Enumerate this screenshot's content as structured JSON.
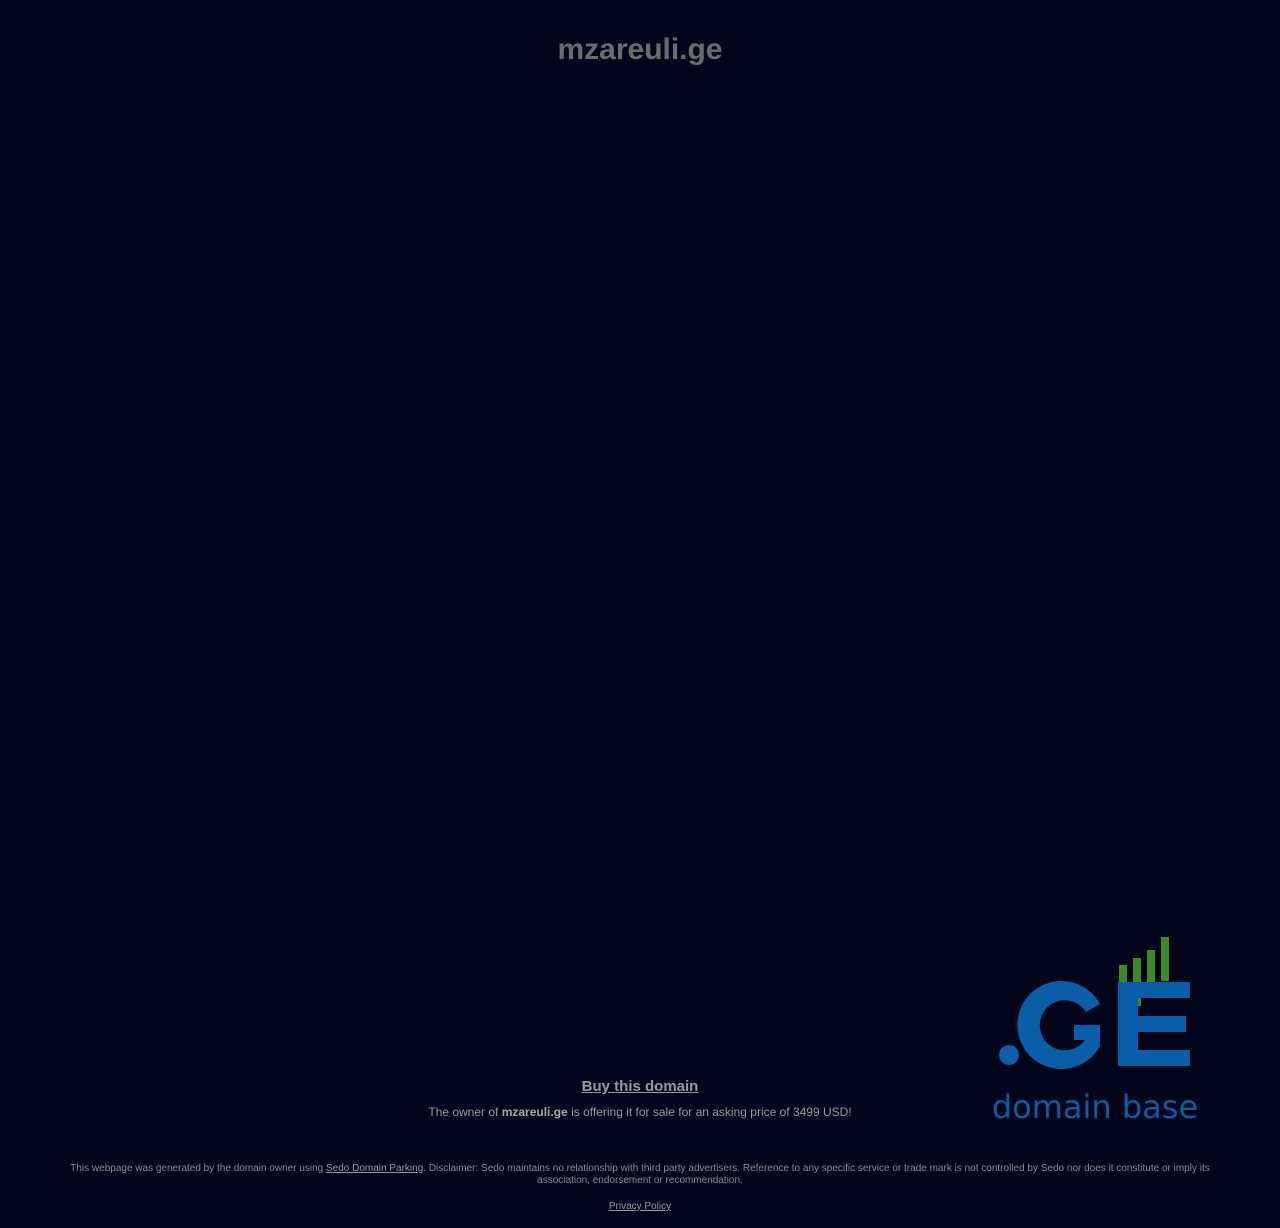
{
  "header": {
    "domain": "mzareuli.ge"
  },
  "logo": {
    "main_text": ".GE",
    "sub_text": "domain base",
    "colors": {
      "blue": "#0a5ea8",
      "green": "#3a8a2a"
    }
  },
  "sale": {
    "buy_label": "Buy this domain",
    "offer_prefix": "The owner of ",
    "offer_domain": "mzareuli.ge",
    "offer_suffix": " is offering it for sale for an asking price of 3499 USD!"
  },
  "footer": {
    "disclaimer_prefix": "This webpage was generated by the domain owner using ",
    "sedo_link": "Sedo Domain Parking",
    "disclaimer_suffix": ". Disclaimer: Sedo maintains no relationship with third party advertisers. Reference to any specific service or trade mark is not controlled by Sedo nor does it constitute or imply its association, endorsement or recommendation.",
    "privacy_label": "Privacy Policy"
  },
  "colors": {
    "background": "#02041a",
    "text": "#9a9a9a",
    "title": "#6b6b6b"
  }
}
